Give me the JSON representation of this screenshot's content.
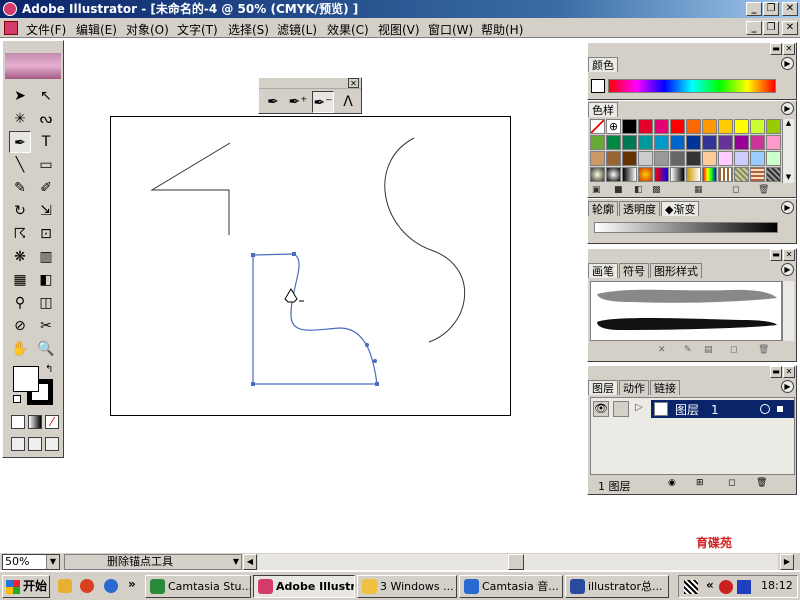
{
  "window": {
    "title": "Adobe Illustrator - [未命名的-4 @ 50% (CMYK/预览) ]",
    "min_glyph": "_",
    "restore_glyph": "❐",
    "close_glyph": "✕"
  },
  "menu": {
    "items": [
      "文件(F)",
      "编辑(E)",
      "对象(O)",
      "文字(T)",
      "选择(S)",
      "滤镜(L)",
      "效果(C)",
      "视图(V)",
      "窗口(W)",
      "帮助(H)"
    ]
  },
  "toolbox": {
    "tools": [
      {
        "name": "selection-tool",
        "glyph": "➤"
      },
      {
        "name": "direct-selection-tool",
        "glyph": "↖"
      },
      {
        "name": "magic-wand-tool",
        "glyph": "✳"
      },
      {
        "name": "lasso-tool",
        "glyph": "ᔓ"
      },
      {
        "name": "pen-tool",
        "glyph": "✒"
      },
      {
        "name": "type-tool",
        "glyph": "T"
      },
      {
        "name": "line-tool",
        "glyph": "╲"
      },
      {
        "name": "rectangle-tool",
        "glyph": "▭"
      },
      {
        "name": "paintbrush-tool",
        "glyph": "✎"
      },
      {
        "name": "pencil-tool",
        "glyph": "✐"
      },
      {
        "name": "rotate-tool",
        "glyph": "↻"
      },
      {
        "name": "scale-tool",
        "glyph": "⇲"
      },
      {
        "name": "warp-tool",
        "glyph": "☈"
      },
      {
        "name": "free-transform-tool",
        "glyph": "⊡"
      },
      {
        "name": "symbol-sprayer-tool",
        "glyph": "❋"
      },
      {
        "name": "column-graph-tool",
        "glyph": "▥"
      },
      {
        "name": "mesh-tool",
        "glyph": "▦"
      },
      {
        "name": "gradient-tool",
        "glyph": "◧"
      },
      {
        "name": "eyedropper-tool",
        "glyph": "⚲"
      },
      {
        "name": "blend-tool",
        "glyph": "◫"
      },
      {
        "name": "slice-tool",
        "glyph": "⊘"
      },
      {
        "name": "scissors-tool",
        "glyph": "✂"
      },
      {
        "name": "hand-tool",
        "glyph": "✋"
      },
      {
        "name": "zoom-tool",
        "glyph": "🔍"
      }
    ]
  },
  "pen_palette": {
    "tools": [
      "pen-tool",
      "add-anchor-point-tool",
      "delete-anchor-point-tool",
      "convert-anchor-point-tool"
    ],
    "glyphs": [
      "✒",
      "✒⁺",
      "✒⁻",
      "ᐱ"
    ]
  },
  "panels": {
    "color": {
      "tabs": [
        "颜色"
      ]
    },
    "swatches": {
      "tabs": [
        "色样"
      ]
    },
    "stroke": {
      "tabs": [
        "轮廓",
        "透明度",
        "◆渐变"
      ]
    },
    "brushes": {
      "tabs": [
        "画笔",
        "符号",
        "图形样式"
      ]
    },
    "layers": {
      "tabs": [
        "图层",
        "动作",
        "链接"
      ],
      "layer_name": "图层　1",
      "footer_count": "1 图层"
    }
  },
  "colors": {
    "swatches_row1": [
      "#ffffff",
      "#ffffff",
      "#000000",
      "#e4002b",
      "#e60073",
      "#ff0000",
      "#ff6600",
      "#ff9900",
      "#ffcc00",
      "#ffff00",
      "#ccff33",
      "#99cc00"
    ],
    "swatches_row2": [
      "#66aa33",
      "#008844",
      "#007755",
      "#009999",
      "#0099cc",
      "#0066cc",
      "#003399",
      "#333399",
      "#663399",
      "#990099",
      "#cc3399",
      "#ff99cc"
    ],
    "swatches_row3": [
      "#cc9966",
      "#996633",
      "#663300",
      "#cccccc",
      "#999999",
      "#666666",
      "#333333",
      "#ffcc99",
      "#ffccff",
      "#ccccff",
      "#99ccff",
      "#ccffcc"
    ],
    "path_blue": "#4a6cc0",
    "layer_row": "#0a246a"
  },
  "status": {
    "zoom": "50%",
    "tool_name": "删除锚点工具"
  },
  "taskbar": {
    "start": "开始",
    "tasks": [
      "Camtasia Stu...",
      "Adobe Illustr...",
      "3 Windows ...",
      "Camtasia 音...",
      "illustrator总..."
    ],
    "clock": "18:12"
  },
  "watermark": {
    "text": "育碟苑"
  }
}
